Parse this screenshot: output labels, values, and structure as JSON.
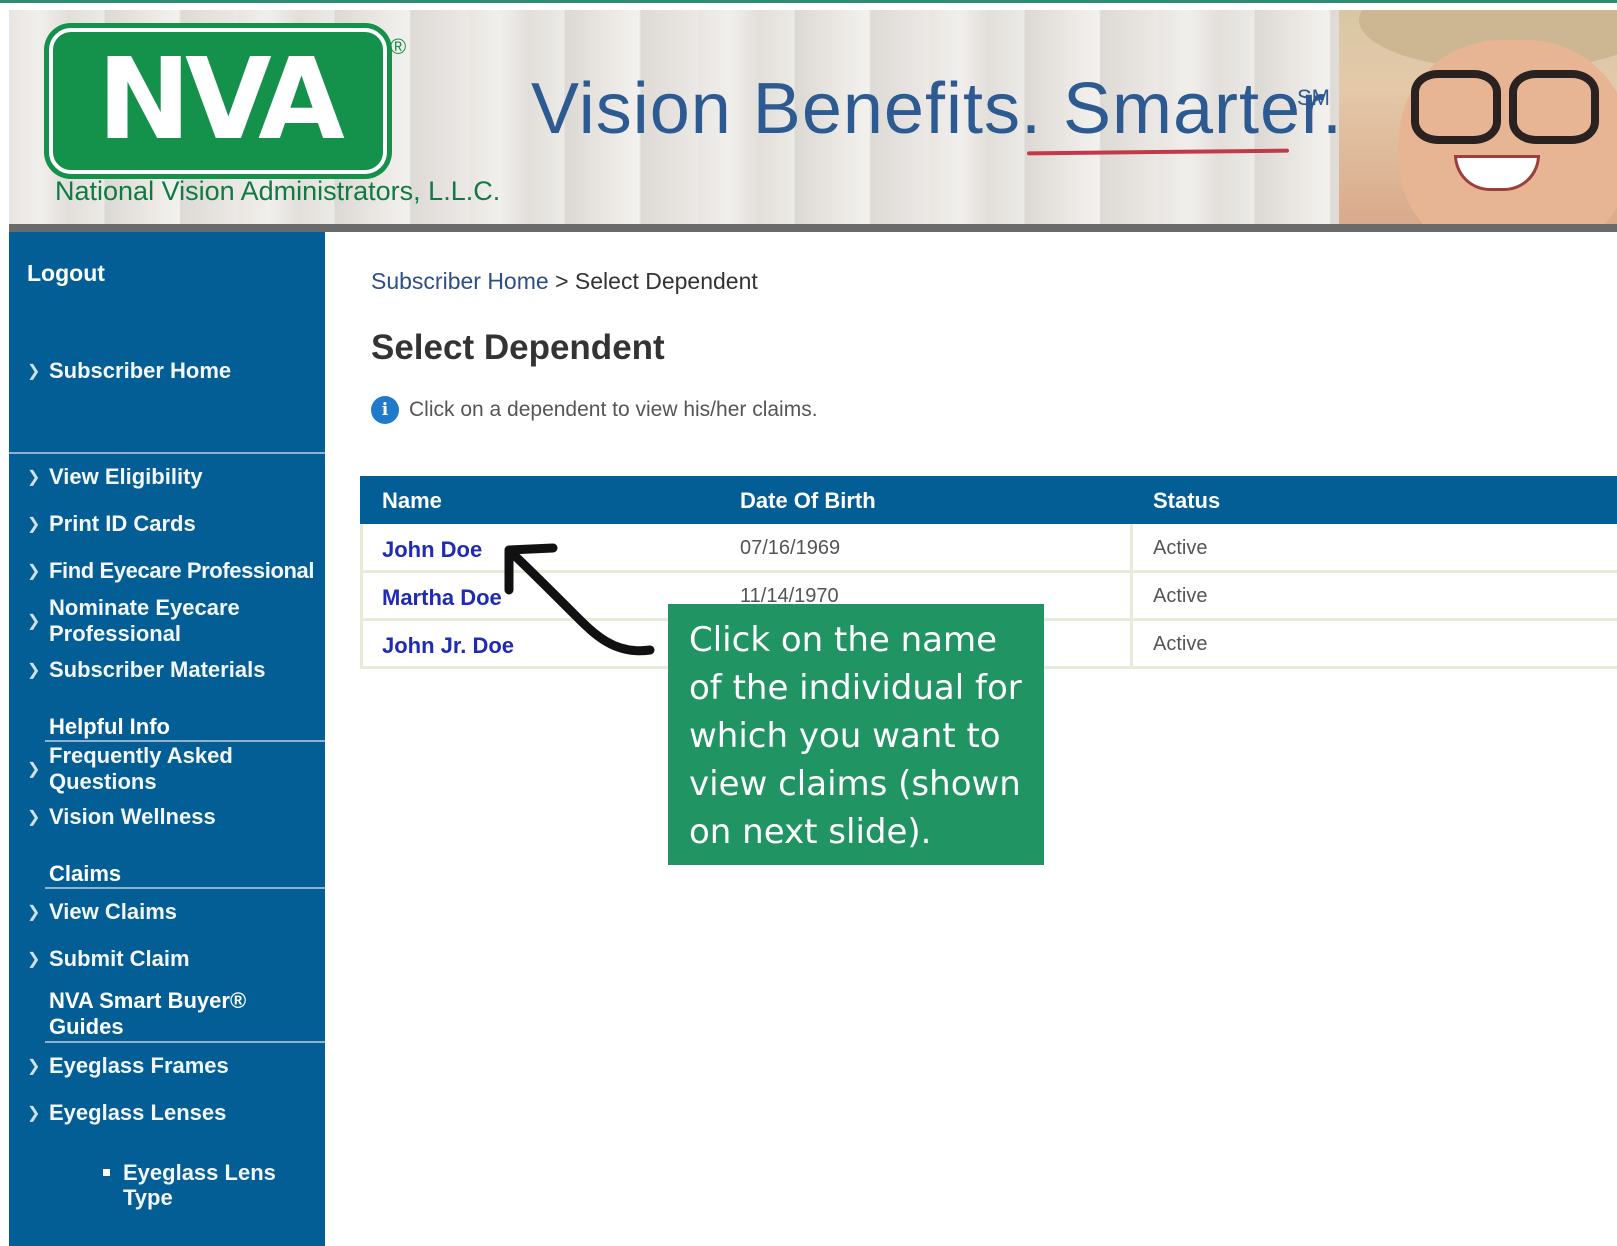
{
  "header": {
    "logo_text": "NVA",
    "logo_registered": "®",
    "company_name": "National Vision Administrators, L.L.C.",
    "tagline": "Vision Benefits. Smarter.",
    "tagline_mark": "SM"
  },
  "sidebar": {
    "logout": "Logout",
    "items": [
      {
        "label": "Subscriber Home"
      },
      {
        "label": "View Eligibility"
      },
      {
        "label": "Print ID Cards"
      },
      {
        "label": "Find Eyecare Professional"
      },
      {
        "label": "Nominate Eyecare Professional"
      },
      {
        "label": "Subscriber Materials"
      }
    ],
    "helpful_heading": "Helpful Info",
    "helpful_items": [
      {
        "label": "Frequently Asked Questions"
      },
      {
        "label": "Vision Wellness"
      }
    ],
    "claims_heading": "Claims",
    "claims_items": [
      {
        "label": "View Claims"
      },
      {
        "label": "Submit Claim"
      }
    ],
    "guides_heading": "NVA Smart Buyer® Guides",
    "guides_items": [
      {
        "label": "Eyeglass Frames"
      },
      {
        "label": "Eyeglass Lenses"
      }
    ],
    "sub_items": [
      {
        "label": "Eyeglass Lens Type"
      }
    ]
  },
  "breadcrumb": {
    "home": "Subscriber Home",
    "separator": ">",
    "current": "Select Dependent"
  },
  "page": {
    "title": "Select Dependent",
    "info": "Click on a dependent to view his/her claims."
  },
  "table": {
    "columns": [
      "Name",
      "Date Of Birth",
      "Status"
    ],
    "rows": [
      {
        "name": "John Doe",
        "dob": "07/16/1969",
        "status": "Active"
      },
      {
        "name": "Martha Doe",
        "dob": "11/14/1970",
        "status": "Active"
      },
      {
        "name": "John Jr. Doe",
        "dob": "",
        "status": "Active"
      }
    ]
  },
  "callout": {
    "text": "Click on the name of the individual for which you want to view claims (shown on next slide)."
  },
  "colors": {
    "sidebar_blue": "#035e96",
    "brand_green": "#14914a",
    "callout_green": "#219463",
    "link_blue": "#1f2bb6"
  },
  "icons": [
    "info-icon",
    "chevron-right-icon",
    "curved-arrow-icon",
    "square-bullet-icon"
  ]
}
